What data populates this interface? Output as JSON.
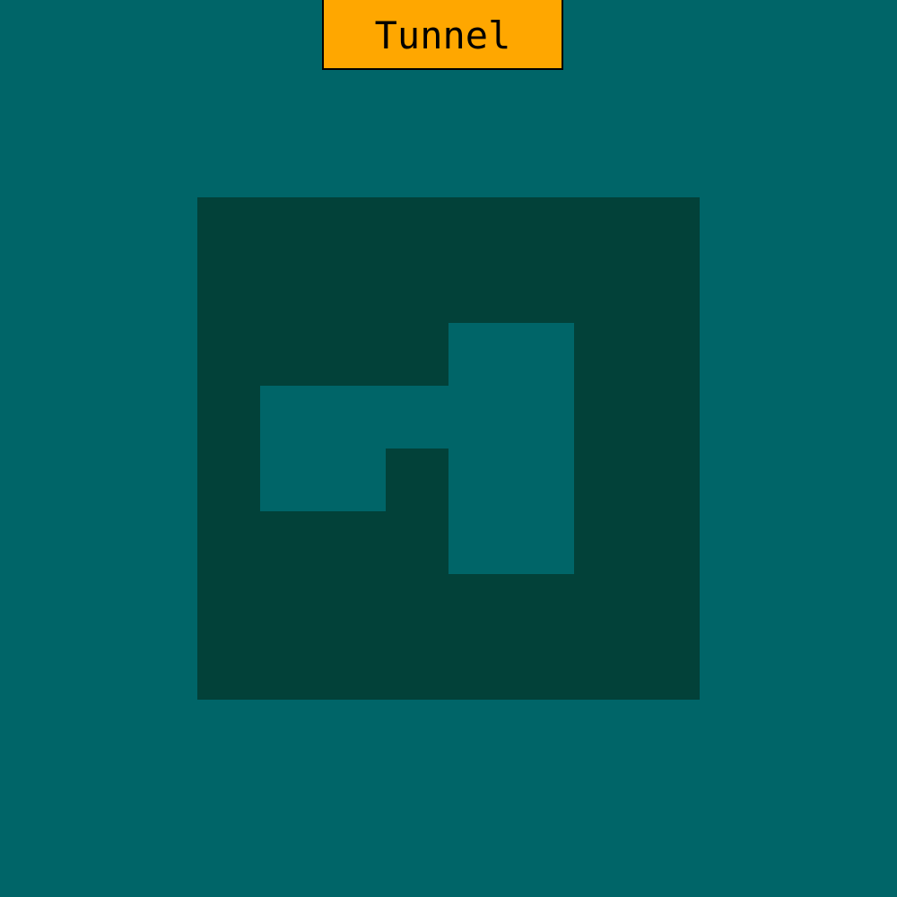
{
  "title": "Tunnel",
  "colors": {
    "background": "#006568",
    "tunnel_wall": "#024139",
    "tunnel_path": "#006568",
    "title_tag": "#FFA700",
    "title_text": "#000000"
  }
}
